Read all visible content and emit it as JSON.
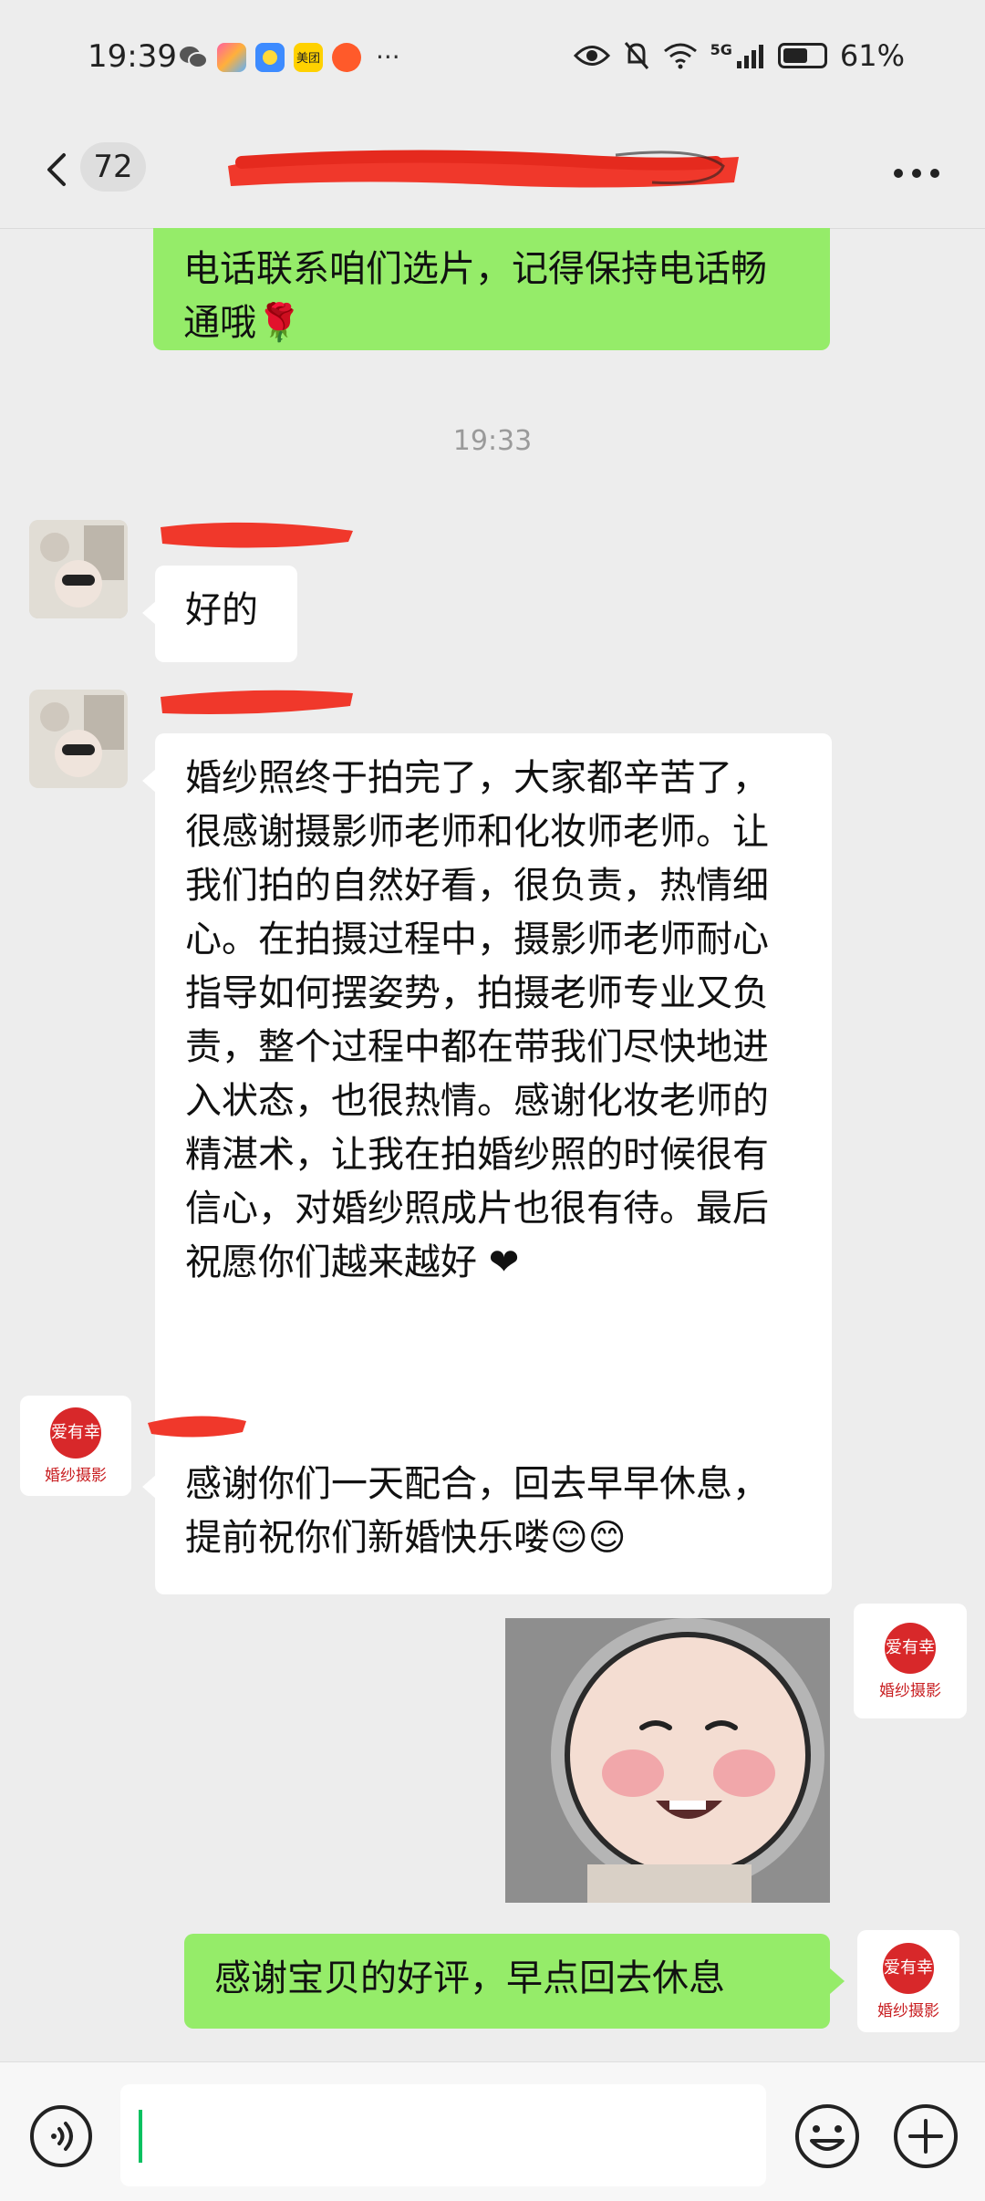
{
  "status_bar": {
    "time": "19:39",
    "more_indicator": "···",
    "app_icons": [
      "wechat-icon",
      "app-icon-multicolor",
      "app-icon-blue",
      "meituan-icon",
      "app-icon-orange"
    ],
    "meituan_label": "美团",
    "network": "5G",
    "battery_percent": "61%",
    "battery_level": 0.61
  },
  "header": {
    "unread_count": "72"
  },
  "messages": {
    "m1_text": "电话联系咱们选片，记得保持电话畅通哦🌹",
    "timestamp": "19:33",
    "m2_text": "好的",
    "m3_text": "婚纱照终于拍完了，大家都辛苦了，很感谢摄影师老师和化妆师老师。让我们拍的自然好看，很负责，热情细心。在拍摄过程中，摄影师老师耐心指导如何摆姿势，拍摄老师专业又负责，整个过程中都在带我们尽快地进入状态，也很热情。感谢化妆老师的精湛术，让我在拍婚纱照的时候很有信心，对婚纱照成片也很有待。最后祝愿你们越来越好 ❤",
    "m4_text": "感谢你们一天配合，回去早早休息，提前祝你们新婚快乐喽😊😊",
    "m6_text": "感谢宝贝的好评，早点回去休息"
  },
  "brand": {
    "logo_text": "婚纱摄影",
    "seal_text": "爱有幸"
  },
  "input": {
    "value": ""
  },
  "colors": {
    "outgoing_bubble": "#95ec69",
    "incoming_bubble": "#ffffff",
    "background": "#ededed",
    "redaction": "#f0382b",
    "brand_red": "#d8282a"
  }
}
